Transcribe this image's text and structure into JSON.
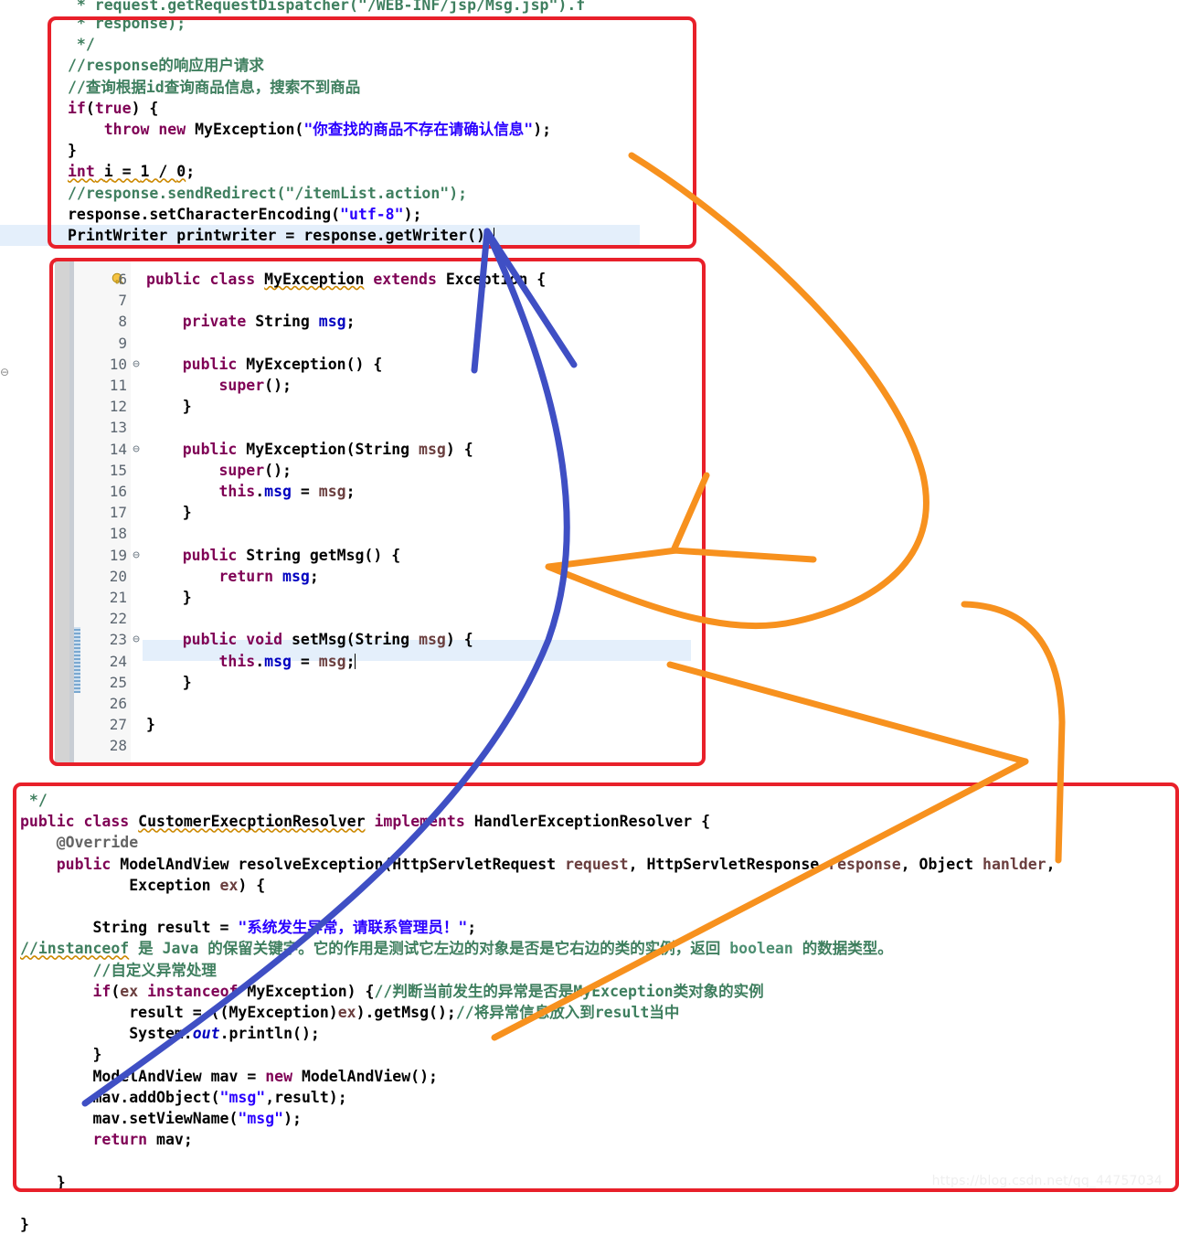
{
  "meta": {
    "watermark": "https://blog.csdn.net/qq_44757034",
    "colors": {
      "annotation_box": "#e8202a",
      "arrow_orange": "#f7911e",
      "arrow_blue": "#3f4fc4",
      "keyword": "#7f0055",
      "string": "#2a00ff",
      "comment": "#3f7f5f",
      "field": "#0000c0",
      "parameter": "#6a3e3e",
      "annotation_kw": "#646464",
      "line_highlight": "#e4effb",
      "gutter": "#f7f7f7"
    }
  },
  "panes": {
    "top": {
      "name": "controller-snippet",
      "cut_top_line": " * request.getRequestDispatcher(\"/WEB-INF/jsp/Msg.jsp\").f",
      "lines": [
        " * response);",
        " */",
        "//response的响应用户请求",
        "//查询根据id查询商品信息，搜索不到商品",
        "if(true) {",
        "    throw new MyException(\"你查找的商品不存在请确认信息\");",
        "}",
        "int i = 1 / 0;",
        "//response.sendRedirect(\"/itemList.action\");",
        "response.setCharacterEncoding(\"utf-8\");",
        "PrintWriter printwriter = response.getWriter();"
      ],
      "highlighted_line": "PrintWriter printwriter = response.getWriter();"
    },
    "middle": {
      "name": "my-exception-class",
      "first_line_number": 6,
      "last_line_number": 28,
      "line_numbers": [
        "6",
        "7",
        "8",
        "9",
        "10",
        "11",
        "12",
        "13",
        "14",
        "15",
        "16",
        "17",
        "18",
        "19",
        "20",
        "21",
        "22",
        "23",
        "24",
        "25",
        "26",
        "27",
        "28"
      ],
      "fold_markers": {
        "10": "⊖",
        "14": "⊖",
        "19": "⊖",
        "23": "⊖"
      },
      "warning_icon_line": "6",
      "changed_lines": [
        "23",
        "24",
        "25"
      ],
      "highlighted_line_number": "24",
      "lines": [
        "public class MyException extends Exception {",
        "",
        "    private String msg;",
        "",
        "    public MyException() {",
        "        super();",
        "    }",
        "",
        "    public MyException(String msg) {",
        "        super();",
        "        this.msg = msg;",
        "    }",
        "",
        "    public String getMsg() {",
        "        return msg;",
        "    }",
        "",
        "    public void setMsg(String msg) {",
        "        this.msg = msg;",
        "    }",
        "",
        "}",
        ""
      ]
    },
    "bottom": {
      "name": "customer-exception-resolver",
      "lines": [
        " */",
        "public class CustomerExecptionResolver implements HandlerExceptionResolver {",
        "    @Override",
        "    public ModelAndView resolveException(HttpServletRequest request, HttpServletResponse response, Object hanlder,",
        "            Exception ex) {",
        "",
        "        String result = \"系统发生异常，请联系管理员！\";",
        "        //instanceof 是 Java 的保留关键字。它的作用是测试它左边的对象是否是它右边的类的实例，返回 boolean 的数据类型。",
        "        //自定义异常处理",
        "        if(ex instanceof MyException) {//判断当前发生的异常是否是MyException类对象的实例",
        "            result = ((MyException)ex).getMsg();//将异常信息放入到result当中",
        "            System.out.println();",
        "        }",
        "        ModelAndView mav = new ModelAndView();",
        "        mav.addObject(\"msg\",result);",
        "        mav.setViewName(\"msg\");",
        "        return mav;",
        "    }",
        "}"
      ]
    }
  },
  "annotations": {
    "boxes": [
      {
        "id": "box-top",
        "label": "red-highlight-box-controller"
      },
      {
        "id": "box-middle",
        "label": "red-highlight-box-myexception"
      },
      {
        "id": "box-bottom",
        "label": "red-highlight-box-resolver"
      }
    ],
    "arrows": [
      {
        "id": "arrow-blue",
        "color": "#3f4fc4",
        "label": "blue-arrow-resolver-to-printwriter"
      },
      {
        "id": "arrow-orange-loop",
        "color": "#f7911e",
        "label": "orange-arrow-top-loop-to-middle"
      },
      {
        "id": "arrow-orange-second",
        "color": "#f7911e",
        "label": "orange-arrow-middle-to-bottom"
      }
    ]
  },
  "stray_glyphs": [
    {
      "id": "fold-stray-left",
      "glyph": "⊖"
    }
  ]
}
